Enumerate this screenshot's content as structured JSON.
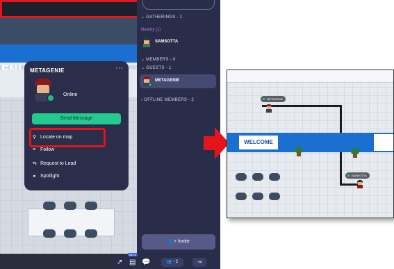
{
  "left_map": {
    "welcome_fragment": "ENI"
  },
  "popup": {
    "username": "METAGENIE",
    "more_glyph": "···",
    "status": "Online",
    "send_message": "Send Message",
    "menu": {
      "locate": "Locate on map",
      "follow": "Follow",
      "request_lead": "Request to Lead",
      "spotlight": "Spotlight"
    }
  },
  "sidebar": {
    "gatherings": "GATHERINGS - 1",
    "nearby": "Nearby (1)",
    "nearby_members": [
      "SAMSOTTA"
    ],
    "members": "MEMBERS - 0",
    "guests": "GUESTS - 1",
    "guest_members": [
      "METAGENIE"
    ],
    "offline": "OFFLINE MEMBERS - 2",
    "invite": "Invite"
  },
  "toolbar": {
    "beta_badge": "BETA",
    "people_count": "2"
  },
  "zoom_map": {
    "welcome": "WELCOME",
    "tags": [
      "METAGENIE",
      "SAMSOTTA"
    ]
  },
  "colors": {
    "highlight_red": "#e3141c",
    "sidebar_bg": "#2a2d4a",
    "accent_green": "#23c98d",
    "nearby_purple": "#b47cf0",
    "welcome_blue": "#1a6fd1"
  },
  "icons": [
    "more-icon",
    "location-pin-icon",
    "follow-icon",
    "request-lead-icon",
    "spotlight-icon",
    "chevron-down-icon",
    "chevron-right-icon",
    "add-user-icon",
    "build-tool-icon",
    "calendar-icon",
    "chat-icon",
    "people-icon",
    "leave-icon",
    "red-arrow-icon"
  ]
}
